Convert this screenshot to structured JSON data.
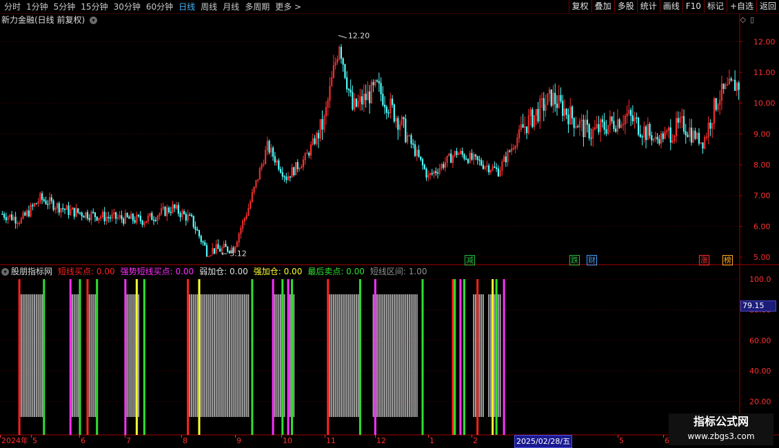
{
  "toolbar": {
    "periods": [
      "分时",
      "1分钟",
      "5分钟",
      "15分钟",
      "30分钟",
      "60分钟",
      "日线",
      "周线",
      "月线",
      "多周期",
      "更多 >"
    ],
    "active_period": "日线",
    "buttons": [
      "复权",
      "叠加",
      "多股",
      "统计",
      "画线",
      "F10",
      "标记",
      "+自选",
      "返回"
    ]
  },
  "stock": {
    "title": "新力金融(日线 前复权)",
    "high_marker": "12.20",
    "low_marker": "5.12",
    "price_axis": [
      "12.00",
      "11.00",
      "10.00",
      "9.00",
      "8.00",
      "7.00",
      "6.00",
      "5.00"
    ],
    "events": [
      {
        "label": "减",
        "color": "#20c040"
      },
      {
        "label": "跌",
        "color": "#20c040"
      },
      {
        "label": "财",
        "color": "#40a0ff"
      },
      {
        "label": "涨",
        "color": "#ff3030"
      },
      {
        "label": "榜",
        "color": "#ffb020"
      }
    ]
  },
  "indicator": {
    "name": "股朋指标网",
    "legend": [
      {
        "text": "短线买点: 0.00",
        "color": "#ff2020"
      },
      {
        "text": "强势短线买点: 0.00",
        "color": "#ff30ff"
      },
      {
        "text": "弱加仓: 0.00",
        "color": "#e0e0e0"
      },
      {
        "text": "强加仓: 0.00",
        "color": "#ffff30"
      },
      {
        "text": "最后卖点: 0.00",
        "color": "#30e030"
      },
      {
        "text": "短线区间: 1.00",
        "color": "#909090"
      }
    ],
    "axis": [
      "100.0",
      "80.00",
      "60.00",
      "40.00",
      "20.00"
    ],
    "current_value": "79.15"
  },
  "date_axis": {
    "labels": [
      "2024年",
      "5",
      "6",
      "7",
      "8",
      "9",
      "10",
      "11",
      "12",
      "1",
      "2",
      "4",
      "5",
      "6"
    ],
    "selected": "2025/02/28/五"
  },
  "watermark": {
    "line1": "指标公式网",
    "line2": "www.zbgs3.com"
  },
  "chart_data": {
    "type": "candlestick",
    "title": "新力金融(日线 前复权)",
    "ylim": [
      4.8,
      12.5
    ],
    "high": 12.2,
    "low": 5.12,
    "anchors": [
      {
        "i": 0,
        "p": 6.4
      },
      {
        "i": 10,
        "p": 6.2
      },
      {
        "i": 20,
        "p": 6.9
      },
      {
        "i": 35,
        "p": 6.5
      },
      {
        "i": 55,
        "p": 6.3
      },
      {
        "i": 75,
        "p": 6.2
      },
      {
        "i": 90,
        "p": 6.6
      },
      {
        "i": 100,
        "p": 6.2
      },
      {
        "i": 108,
        "p": 5.2
      },
      {
        "i": 122,
        "p": 5.3
      },
      {
        "i": 130,
        "p": 6.6
      },
      {
        "i": 140,
        "p": 8.6
      },
      {
        "i": 150,
        "p": 7.6
      },
      {
        "i": 160,
        "p": 8.2
      },
      {
        "i": 170,
        "p": 9.4
      },
      {
        "i": 178,
        "p": 12.0
      },
      {
        "i": 185,
        "p": 9.8
      },
      {
        "i": 198,
        "p": 10.5
      },
      {
        "i": 210,
        "p": 9.4
      },
      {
        "i": 225,
        "p": 7.6
      },
      {
        "i": 240,
        "p": 8.4
      },
      {
        "i": 262,
        "p": 7.8
      },
      {
        "i": 275,
        "p": 9.2
      },
      {
        "i": 290,
        "p": 10.2
      },
      {
        "i": 310,
        "p": 9.0
      },
      {
        "i": 330,
        "p": 9.6
      },
      {
        "i": 345,
        "p": 8.8
      },
      {
        "i": 360,
        "p": 9.3
      },
      {
        "i": 370,
        "p": 8.7
      },
      {
        "i": 378,
        "p": 10.2
      },
      {
        "i": 387,
        "p": 10.6
      }
    ],
    "indicator_bands": [
      [
        9,
        22
      ],
      [
        36,
        41
      ],
      [
        45,
        50
      ],
      [
        65,
        72
      ],
      [
        98,
        130
      ],
      [
        143,
        149
      ],
      [
        151,
        154
      ],
      [
        172,
        188
      ],
      [
        196,
        219
      ],
      [
        249,
        254
      ],
      [
        257,
        263
      ]
    ],
    "signal_lines": [
      {
        "i": 9,
        "color": "#ff2020"
      },
      {
        "i": 22,
        "color": "#30e030"
      },
      {
        "i": 36,
        "color": "#ff30ff"
      },
      {
        "i": 41,
        "color": "#30e030"
      },
      {
        "i": 45,
        "color": "#ff2020"
      },
      {
        "i": 50,
        "color": "#30e030"
      },
      {
        "i": 65,
        "color": "#ff30ff"
      },
      {
        "i": 71,
        "color": "#ffff30"
      },
      {
        "i": 75,
        "color": "#30e030"
      },
      {
        "i": 98,
        "color": "#ff2020"
      },
      {
        "i": 104,
        "color": "#ffff30"
      },
      {
        "i": 132,
        "color": "#30e030"
      },
      {
        "i": 143,
        "color": "#ff30ff"
      },
      {
        "i": 148,
        "color": "#30e030"
      },
      {
        "i": 151,
        "color": "#ff30ff"
      },
      {
        "i": 153,
        "color": "#30e030"
      },
      {
        "i": 172,
        "color": "#ff2020"
      },
      {
        "i": 189,
        "color": "#30e030"
      },
      {
        "i": 197,
        "color": "#ff30ff"
      },
      {
        "i": 222,
        "color": "#30e030"
      },
      {
        "i": 238,
        "color": "#ff2020"
      },
      {
        "i": 239,
        "color": "#30e030"
      },
      {
        "i": 242,
        "color": "#ff30ff"
      },
      {
        "i": 244,
        "color": "#30e030"
      },
      {
        "i": 251,
        "color": "#ff2020"
      },
      {
        "i": 259,
        "color": "#ffff30"
      },
      {
        "i": 261,
        "color": "#30e030"
      },
      {
        "i": 265,
        "color": "#ff30ff"
      }
    ]
  }
}
